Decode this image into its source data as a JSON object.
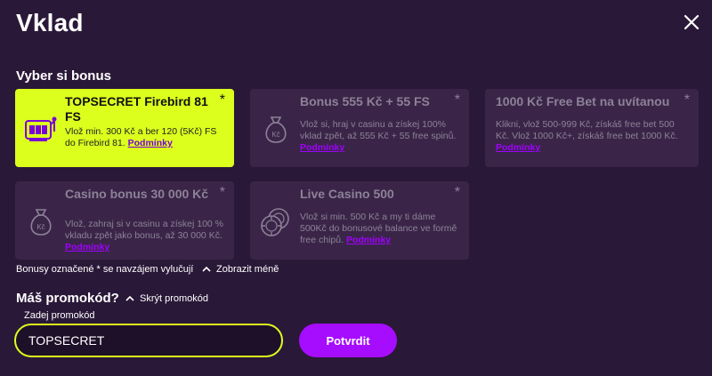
{
  "header": {
    "title": "Vklad"
  },
  "bonus_section": {
    "label": "Vyber si bonus",
    "cards": [
      {
        "title": "TOPSECRET Firebird 81 FS",
        "star": "*",
        "desc": "Vlož min. 300 Kč a ber 120 (5Kč) FS do Firebird 81. ",
        "link": "Podmínky",
        "icon": "slot-machine-icon",
        "selected": true
      },
      {
        "title": "Bonus 555 Kč + 55 FS",
        "star": "*",
        "desc": "Vlož si, hraj v casinu a získej 100% vklad zpět, až 555 Kč + 55 free spinů. ",
        "link": "Podmínky",
        "icon": "money-bag-icon",
        "icon_text": "Kč",
        "selected": false
      },
      {
        "title": "1000 Kč Free Bet na uvítanou",
        "star": "*",
        "desc": "Klikni, vlož 500-999 Kč, získáš free bet 500 Kč. Vlož 1000 Kč+, získáš free bet 1000 Kč. ",
        "link": "Podmínky",
        "selected": false
      },
      {
        "title": "Casino bonus 30 000 Kč",
        "star": "*",
        "desc": "Vlož, zahraj si v casinu a získej 100 % vkladu zpět jako bonus, až 30 000 Kč. ",
        "link": "Podmínky",
        "icon": "money-bag-icon",
        "icon_text": "Kč",
        "selected": false
      },
      {
        "title": "Live Casino 500",
        "star": "*",
        "desc": "Vlož si min. 500 Kč a my ti dáme 500Kč do bonusové balance ve formě free chipů. ",
        "link": "Podmínky",
        "icon": "casino-chips-icon",
        "selected": false
      }
    ],
    "note": "Bonusy označené * se navzájem vylučují",
    "toggle_label": "Zobrazit méně"
  },
  "promo": {
    "question": "Máš promokód?",
    "hide_label": "Skrýt promokód",
    "input_label": "Zadej promokód",
    "input_value": "TOPSECRET",
    "confirm_label": "Potvrdit"
  },
  "colors": {
    "background": "#2a1838",
    "card": "#3a2548",
    "accent_lime": "#dcff1e",
    "accent_purple": "#a60dff"
  }
}
